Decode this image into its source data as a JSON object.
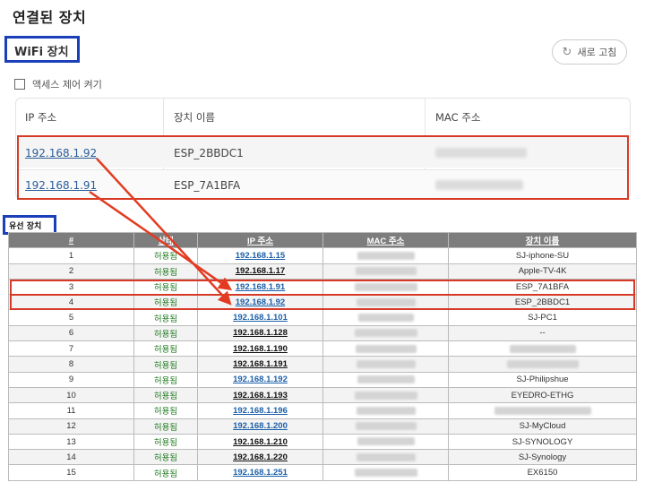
{
  "title": "연결된 장치",
  "wifi": {
    "title": "WiFi 장치",
    "refresh_label": "새로 고침",
    "access_control_label": "액세스 제어 켜기",
    "columns": [
      "IP 주소",
      "장치 이름",
      "MAC 주소"
    ],
    "rows": [
      {
        "ip": "192.168.1.92",
        "name": "ESP_2BBDC1"
      },
      {
        "ip": "192.168.1.91",
        "name": "ESP_7A1BFA"
      }
    ]
  },
  "wired": {
    "title": "유선 장치",
    "columns": [
      "#",
      "상태",
      "IP 주소",
      "MAC 주소",
      "장치 이름"
    ],
    "rows": [
      {
        "num": "1",
        "status": "허용됨",
        "ip": "192.168.1.15",
        "name": "SJ-iphone-SU"
      },
      {
        "num": "2",
        "status": "허용됨",
        "ip": "192.168.1.17",
        "name": "Apple-TV-4K"
      },
      {
        "num": "3",
        "status": "허용됨",
        "ip": "192.168.1.91",
        "name": "ESP_7A1BFA"
      },
      {
        "num": "4",
        "status": "허용됨",
        "ip": "192.168.1.92",
        "name": "ESP_2BBDC1"
      },
      {
        "num": "5",
        "status": "허용됨",
        "ip": "192.168.1.101",
        "name": "SJ-PC1"
      },
      {
        "num": "6",
        "status": "허용됨",
        "ip": "192.168.1.128",
        "name": "--"
      },
      {
        "num": "7",
        "status": "허용됨",
        "ip": "192.168.1.190",
        "name": ""
      },
      {
        "num": "8",
        "status": "허용됨",
        "ip": "192.168.1.191",
        "name": ""
      },
      {
        "num": "9",
        "status": "허용됨",
        "ip": "192.168.1.192",
        "name": "SJ-Philipshue"
      },
      {
        "num": "10",
        "status": "허용됨",
        "ip": "192.168.1.193",
        "name": "EYEDRO-ETHG"
      },
      {
        "num": "11",
        "status": "허용됨",
        "ip": "192.168.1.196",
        "name": ""
      },
      {
        "num": "12",
        "status": "허용됨",
        "ip": "192.168.1.200",
        "name": "SJ-MyCloud"
      },
      {
        "num": "13",
        "status": "허용됨",
        "ip": "192.168.1.210",
        "name": "SJ-SYNOLOGY"
      },
      {
        "num": "14",
        "status": "허용됨",
        "ip": "192.168.1.220",
        "name": "SJ-Synology"
      },
      {
        "num": "15",
        "status": "허용됨",
        "ip": "192.168.1.251",
        "name": "EX6150"
      }
    ]
  },
  "colors": {
    "highlight_red": "#d63a26",
    "highlight_blue": "#1a3fb8",
    "link_blue": "#1b5fa8",
    "status_green": "#1f7a1f",
    "header_gray": "#7d7d7d"
  },
  "icons": {
    "refresh": "refresh-icon",
    "checkbox": "checkbox-icon"
  }
}
